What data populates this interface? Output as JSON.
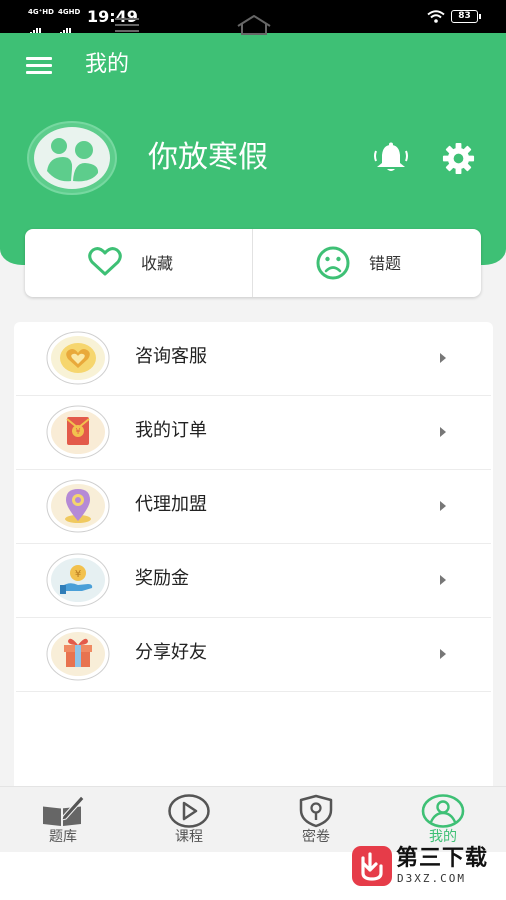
{
  "status_bar": {
    "signal1": "4G⁺HD",
    "signal2": "4GHD",
    "time": "19:49",
    "battery": "83"
  },
  "header": {
    "title": "我的",
    "username": "你放寒假"
  },
  "quick_actions": [
    {
      "label": "收藏",
      "icon": "heart-icon"
    },
    {
      "label": "错题",
      "icon": "sad-face-icon"
    }
  ],
  "menu": [
    {
      "label": "咨询客服",
      "icon": "heart-badge-icon"
    },
    {
      "label": "我的订单",
      "icon": "red-envelope-icon"
    },
    {
      "label": "代理加盟",
      "icon": "location-pin-icon"
    },
    {
      "label": "奖励金",
      "icon": "coin-hand-icon"
    },
    {
      "label": "分享好友",
      "icon": "gift-box-icon"
    }
  ],
  "tabs": [
    {
      "label": "题库",
      "icon": "book-pen-icon",
      "active": false
    },
    {
      "label": "课程",
      "icon": "play-circle-icon",
      "active": false
    },
    {
      "label": "密卷",
      "icon": "shield-lock-icon",
      "active": false
    },
    {
      "label": "我的",
      "icon": "user-circle-icon",
      "active": true
    }
  ],
  "watermark": {
    "title": "第三下载",
    "subtitle": "D3XZ.COM"
  },
  "colors": {
    "brand": "#3ec075",
    "text": "#222222"
  }
}
